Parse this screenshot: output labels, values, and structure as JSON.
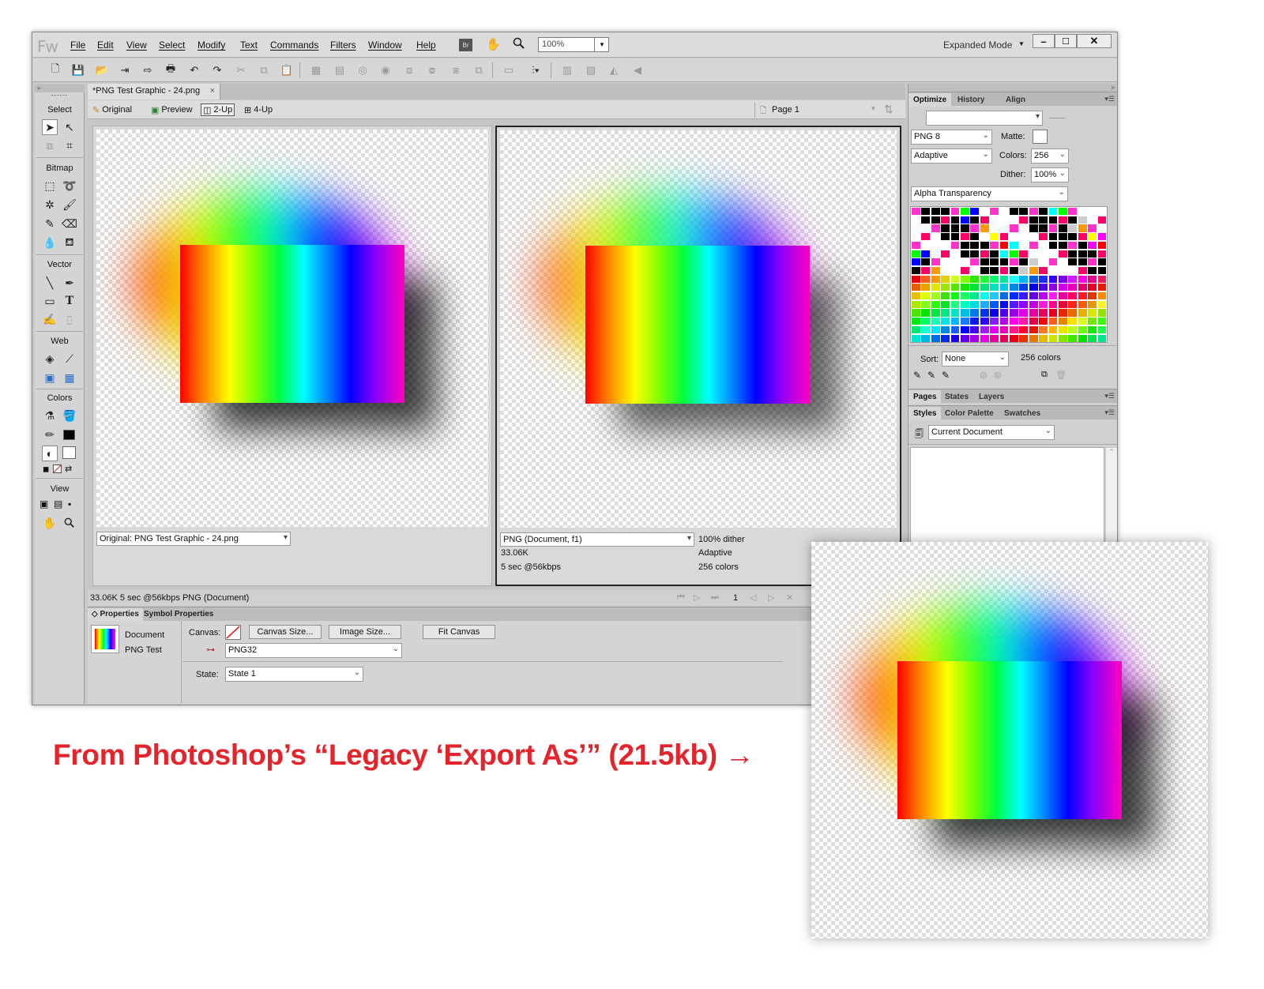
{
  "app": {
    "logo": "Fw",
    "menu": [
      "File",
      "Edit",
      "View",
      "Select",
      "Modify",
      "Text",
      "Commands",
      "Filters",
      "Window",
      "Help"
    ],
    "bridge_label": "Br",
    "zoom": "100%",
    "mode": "Expanded Mode"
  },
  "tools": {
    "header": "»",
    "sections": [
      "Select",
      "Bitmap",
      "Vector",
      "Web",
      "Colors",
      "View"
    ]
  },
  "document": {
    "tab_title": "*PNG Test Graphic - 24.png",
    "tab_close": "×",
    "view_tabs": [
      "Original",
      "Preview",
      "2-Up",
      "4-Up"
    ],
    "page_label": "Page 1",
    "left_pane": {
      "source": "Original: PNG Test Graphic - 24.png"
    },
    "right_pane": {
      "format": "PNG (Document, f1)",
      "dither": "100% dither",
      "size": "33.06K",
      "palette": "Adaptive",
      "time": "5 sec @56kbps",
      "colors": "256 colors"
    },
    "status": "33.06K  5 sec @56kbps  PNG (Document)",
    "frame_number": "1"
  },
  "properties": {
    "tabs": [
      "◇ Properties",
      "Symbol Properties"
    ],
    "doc_label": "Document",
    "doc_name": "PNG Test",
    "canvas_label": "Canvas:",
    "canvas_size_btn": "Canvas Size...",
    "image_size_btn": "Image Size...",
    "fit_canvas_btn": "Fit Canvas",
    "export_format": "PNG32",
    "state_label": "State:",
    "state_value": "State 1"
  },
  "optimize": {
    "tabs": [
      "Optimize",
      "History",
      "Align"
    ],
    "preset": "",
    "format": "PNG 8",
    "matte_label": "Matte:",
    "palette": "Adaptive",
    "colors_label": "Colors:",
    "colors_value": "256",
    "dither_label": "Dither:",
    "dither_value": "100%",
    "transparency": "Alpha Transparency",
    "sort_label": "Sort:",
    "sort_value": "None",
    "color_count": "256 colors"
  },
  "pages_panel": {
    "tabs": [
      "Pages",
      "States",
      "Layers"
    ]
  },
  "styles_panel": {
    "tabs": [
      "Styles",
      "Color Palette",
      "Swatches"
    ],
    "library": "Current Document"
  },
  "caption": "From Photoshop’s “Legacy ‘Export As’” (21.5kb) →",
  "colors": {
    "caption": "#e5232b",
    "canvas_none": "#d22"
  }
}
